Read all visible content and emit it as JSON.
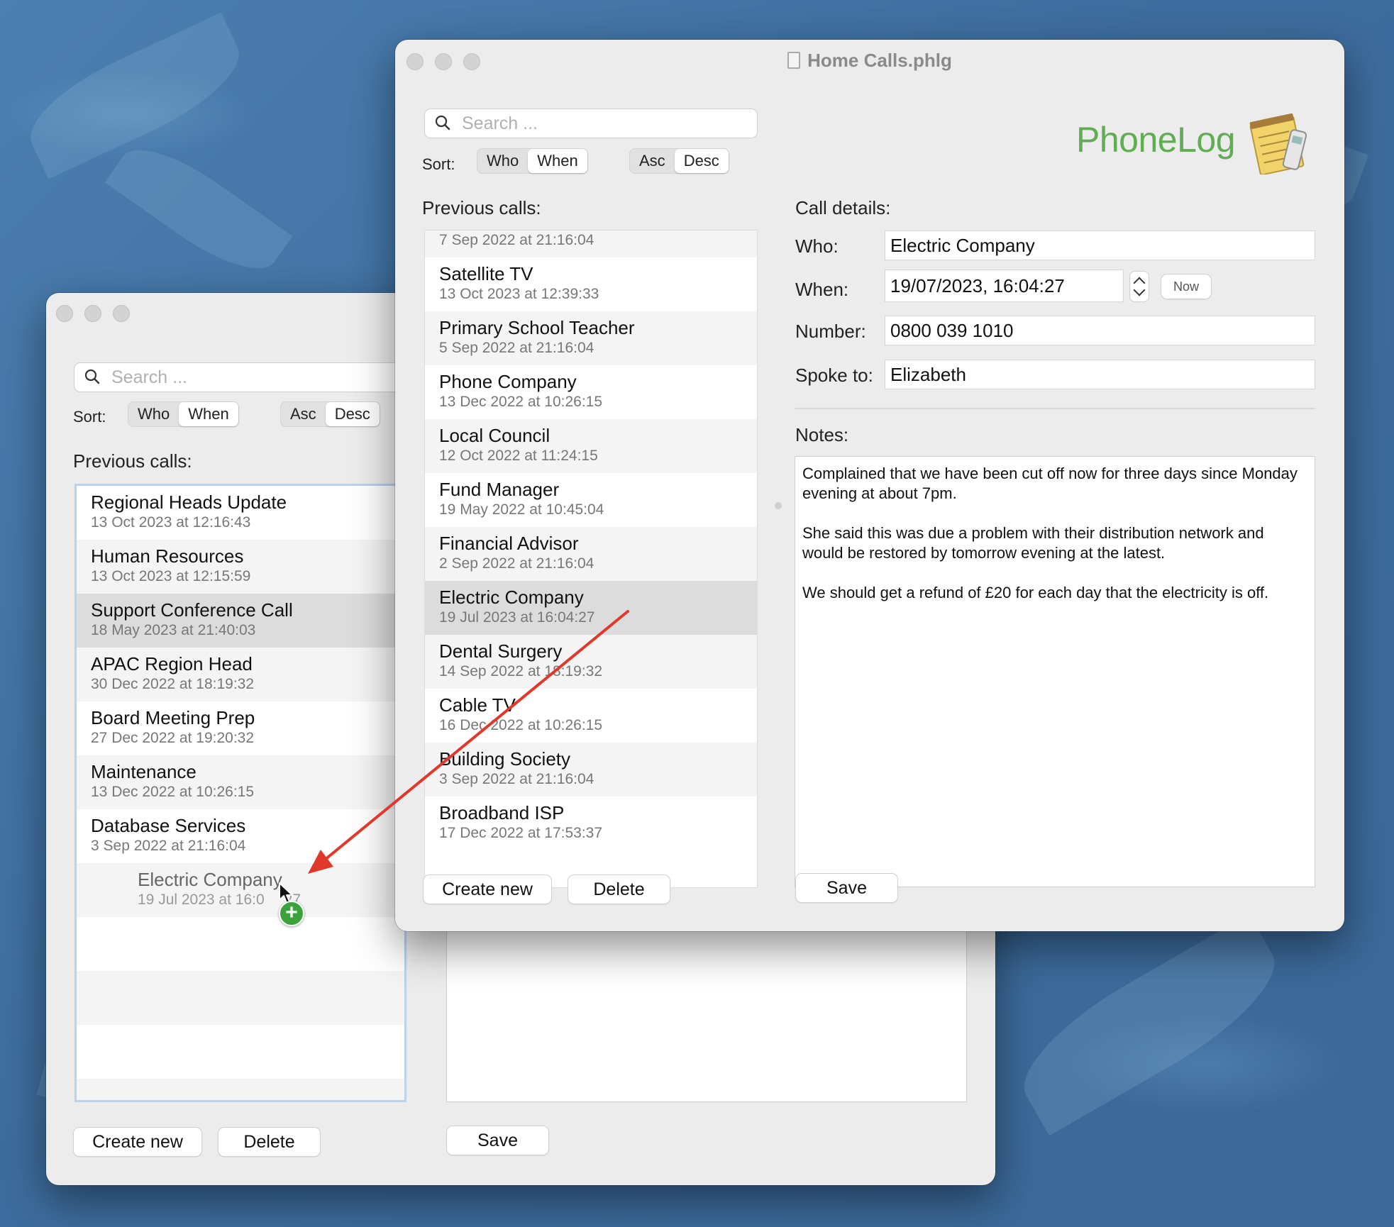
{
  "background_window": {
    "search": {
      "placeholder": "Search ..."
    },
    "sort": {
      "label": "Sort:",
      "by": [
        "Who",
        "When"
      ],
      "order": [
        "Asc",
        "Desc"
      ]
    },
    "list_header": "Previous calls:",
    "calls": [
      {
        "name": "Regional Heads Update",
        "date": "13 Oct 2023 at 12:16:43"
      },
      {
        "name": "Human Resources",
        "date": "13 Oct 2023 at 12:15:59"
      },
      {
        "name": "Support Conference Call",
        "date": "18 May 2023 at 21:40:03"
      },
      {
        "name": "APAC Region Head",
        "date": "30 Dec 2022 at 18:19:32"
      },
      {
        "name": "Board Meeting Prep",
        "date": "27 Dec 2022 at 19:20:32"
      },
      {
        "name": "Maintenance",
        "date": "13 Dec 2022 at 10:26:15"
      },
      {
        "name": "Database Services",
        "date": "3 Sep 2022 at 21:16:04"
      }
    ],
    "drag_ghost": {
      "name": "Electric Company",
      "date": "19 Jul 2023 at 16:0",
      "date_tail": "27"
    },
    "create_label": "Create new",
    "delete_label": "Delete",
    "save_label": "Save"
  },
  "front_window": {
    "title": "Home Calls.phlg",
    "brand": "PhoneLog",
    "search": {
      "placeholder": "Search ..."
    },
    "sort": {
      "label": "Sort:",
      "by": [
        "Who",
        "When"
      ],
      "order": [
        "Asc",
        "Desc"
      ]
    },
    "list_header": "Previous calls:",
    "partial_top_date": "7 Sep 2022 at 21:16:04",
    "calls": [
      {
        "name": "Satellite TV",
        "date": "13 Oct 2023 at 12:39:33"
      },
      {
        "name": "Primary School Teacher",
        "date": "5 Sep 2022 at 21:16:04"
      },
      {
        "name": "Phone Company",
        "date": "13 Dec 2022 at 10:26:15"
      },
      {
        "name": "Local Council",
        "date": "12 Oct 2022 at 11:24:15"
      },
      {
        "name": "Fund Manager",
        "date": "19 May 2022 at 10:45:04"
      },
      {
        "name": "Financial Advisor",
        "date": "2 Sep 2022 at 21:16:04"
      },
      {
        "name": "Electric Company",
        "date": "19 Jul 2023 at 16:04:27"
      },
      {
        "name": "Dental Surgery",
        "date": "14 Sep 2022 at 18:19:32"
      },
      {
        "name": "Cable TV",
        "date": "16 Dec 2022 at 10:26:15"
      },
      {
        "name": "Building Society",
        "date": "3 Sep 2022 at 21:16:04"
      },
      {
        "name": "Broadband ISP",
        "date": "17 Dec 2022 at 17:53:37"
      }
    ],
    "selected_call": "Electric Company",
    "create_label": "Create new",
    "delete_label": "Delete",
    "details": {
      "header": "Call details:",
      "who_label": "Who:",
      "who": "Electric Company",
      "when_label": "When:",
      "when": "19/07/2023, 16:04:27",
      "now_label": "Now",
      "number_label": "Number:",
      "number": "0800 039 1010",
      "spoke_label": "Spoke to:",
      "spoke_to": "Elizabeth",
      "notes_label": "Notes:",
      "notes": [
        "Complained that we have been cut off now for three days since Monday evening at about 7pm.",
        "She said this was due a problem with their distribution network and would be restored by tomorrow evening at the latest.",
        "We should get a refund of £20 for each day that the electricity is off."
      ],
      "save_label": "Save"
    }
  },
  "colors": {
    "brand": "#5fae52",
    "arrow": "#e0392b",
    "add_badge": "#3ca33c"
  }
}
